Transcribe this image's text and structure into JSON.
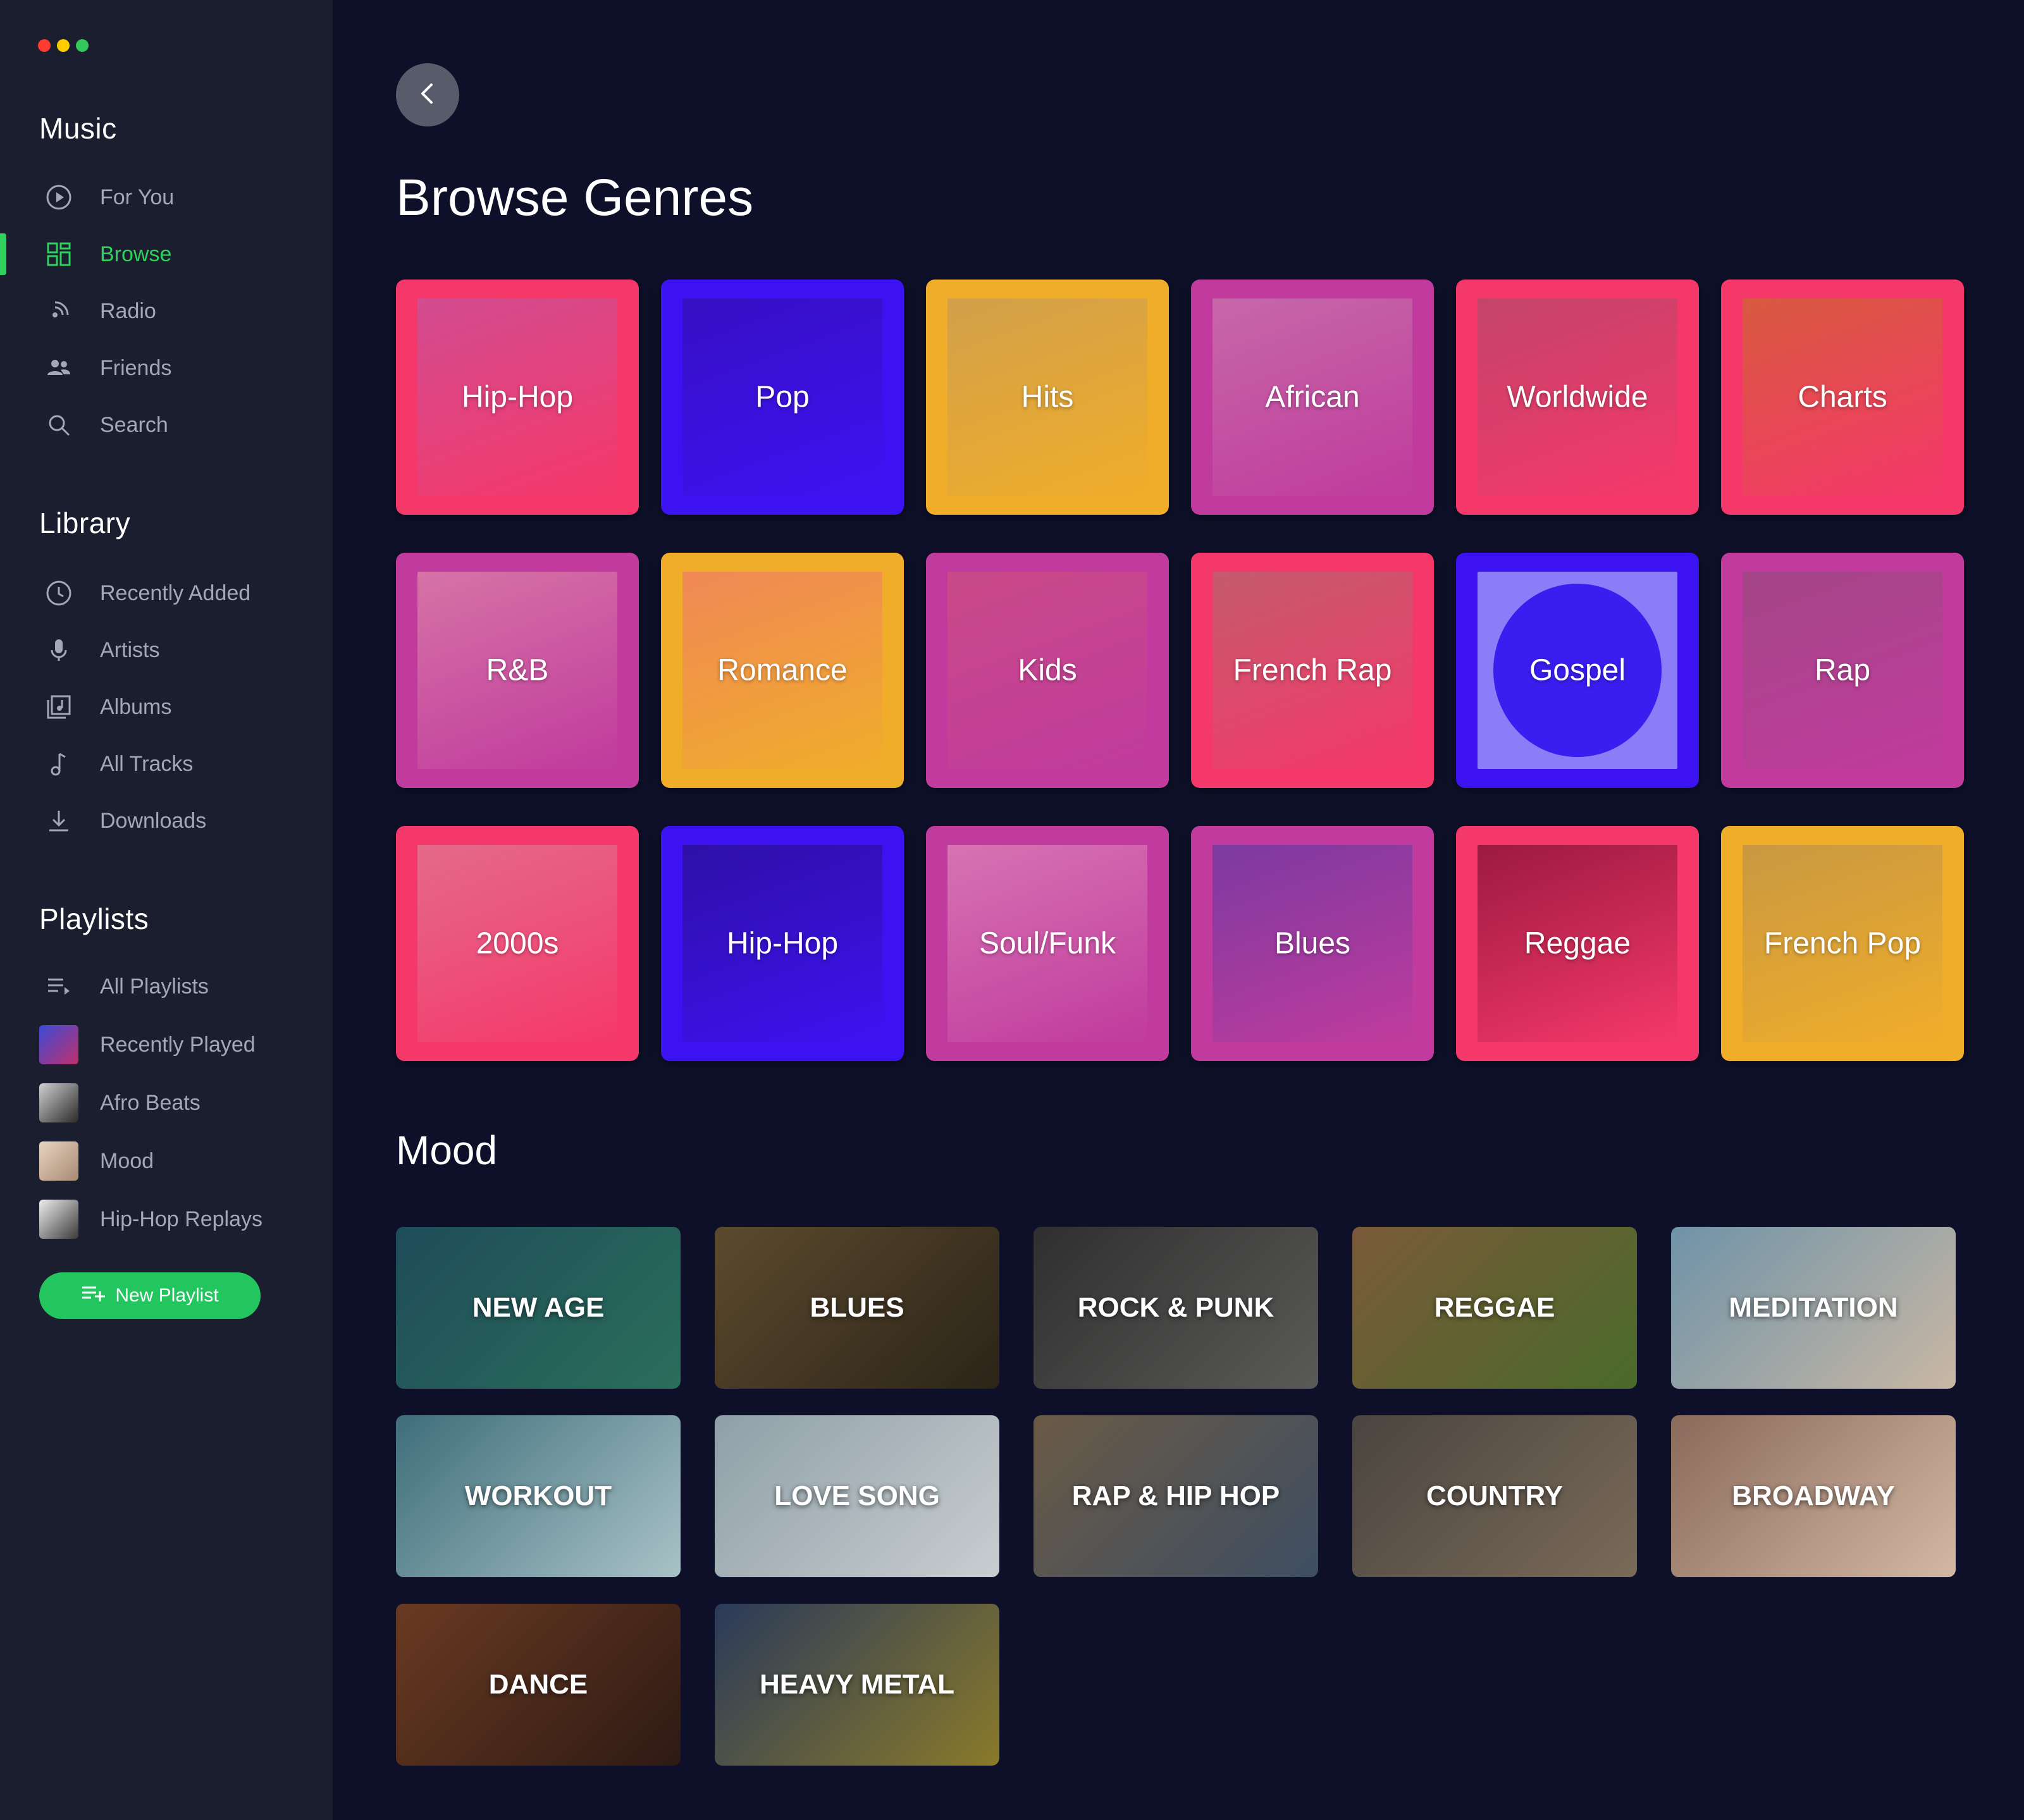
{
  "colors": {
    "accent": "#2ed15c",
    "button_green": "#22c55e",
    "sidebar_bg": "#1b1e2f",
    "main_bg": "#0d1028",
    "traffic_red": "#ff3b30",
    "traffic_yellow": "#ffcc00",
    "traffic_green": "#34c759"
  },
  "sidebar": {
    "music_title": "Music",
    "music_items": [
      {
        "label": "For You",
        "icon": "play-circle-icon"
      },
      {
        "label": "Browse",
        "icon": "grid-icon",
        "active": true
      },
      {
        "label": "Radio",
        "icon": "radio-icon"
      },
      {
        "label": "Friends",
        "icon": "friends-icon"
      },
      {
        "label": "Search",
        "icon": "search-icon"
      }
    ],
    "library_title": "Library",
    "library_items": [
      {
        "label": "Recently Added",
        "icon": "clock-icon"
      },
      {
        "label": "Artists",
        "icon": "microphone-icon"
      },
      {
        "label": "Albums",
        "icon": "album-icon"
      },
      {
        "label": "All Tracks",
        "icon": "music-note-icon"
      },
      {
        "label": "Downloads",
        "icon": "download-icon"
      }
    ],
    "playlists_title": "Playlists",
    "playlist_items": [
      {
        "label": "All Playlists",
        "icon": "playlist-icon"
      },
      {
        "label": "Recently Played",
        "thumb": "#6b3fb3"
      },
      {
        "label": "Afro Beats",
        "thumb": "#4a4a4a"
      },
      {
        "label": "Mood",
        "thumb": "#c9a98e"
      },
      {
        "label": "Hip-Hop Replays",
        "thumb": "#8a8a8a"
      }
    ],
    "new_playlist_label": "New Playlist"
  },
  "main": {
    "title": "Browse Genres",
    "genres": [
      {
        "label": "Hip-Hop",
        "frame": "#f5386a",
        "art": "#d24c8f"
      },
      {
        "label": "Pop",
        "frame": "#3d12f2",
        "art": "#3710c4"
      },
      {
        "label": "Hits",
        "frame": "#f0ad2a",
        "art": "#d2a04a"
      },
      {
        "label": "African",
        "frame": "#c03b9d",
        "art": "#c668a8"
      },
      {
        "label": "Worldwide",
        "frame": "#f5386a",
        "art": "#c44469"
      },
      {
        "label": "Charts",
        "frame": "#f5386a",
        "art": "#d8593f"
      },
      {
        "label": "R&B",
        "frame": "#c03b9d",
        "art": "#d673a6"
      },
      {
        "label": "Romance",
        "frame": "#f0ad2a",
        "art": "#f08856"
      },
      {
        "label": "Kids",
        "frame": "#c03b9d",
        "art": "#c94a88"
      },
      {
        "label": "French Rap",
        "frame": "#f5386a",
        "art": "#c45a6d"
      },
      {
        "label": "Gospel",
        "frame": "#3d12f2",
        "art": "#8b7cf8",
        "disc": true
      },
      {
        "label": "Rap",
        "frame": "#c03b9d",
        "art": "#a44687"
      },
      {
        "label": "2000s",
        "frame": "#f5386a",
        "art": "#e46a8a"
      },
      {
        "label": "Hip-Hop",
        "frame": "#3d12f2",
        "art": "#2d10a6"
      },
      {
        "label": "Soul/Funk",
        "frame": "#c03b9d",
        "art": "#d773b3"
      },
      {
        "label": "Blues",
        "frame": "#c03b9d",
        "art": "#7c3aa0"
      },
      {
        "label": "Reggae",
        "frame": "#f5386a",
        "art": "#9c1a3f"
      },
      {
        "label": "French Pop",
        "frame": "#f0ad2a",
        "art": "#c99841"
      }
    ],
    "mood_title": "Mood",
    "moods": [
      {
        "label": "NEW AGE",
        "bg": "#1f4c5a",
        "bg2": "#2a6e5a"
      },
      {
        "label": "BLUES",
        "bg": "#5c4a2e",
        "bg2": "#2b2418"
      },
      {
        "label": "ROCK & PUNK",
        "bg": "#2f2f2f",
        "bg2": "#5a5a58"
      },
      {
        "label": "REGGAE",
        "bg": "#7a5a3a",
        "bg2": "#4a6a2a"
      },
      {
        "label": "MEDITATION",
        "bg": "#6f93a8",
        "bg2": "#c9b7a4"
      },
      {
        "label": "WORKOUT",
        "bg": "#3e6e7a",
        "bg2": "#a9c2c7"
      },
      {
        "label": "LOVE SONG",
        "bg": "#8fa0a8",
        "bg2": "#c8cdd0"
      },
      {
        "label": "RAP & HIP HOP",
        "bg": "#6a5a46",
        "bg2": "#3e4e62"
      },
      {
        "label": "COUNTRY",
        "bg": "#4a4540",
        "bg2": "#7a6a58"
      },
      {
        "label": "BROADWAY",
        "bg": "#8a6a5a",
        "bg2": "#d3b8a5"
      },
      {
        "label": "DANCE",
        "bg": "#6a3a22",
        "bg2": "#2e1a14"
      },
      {
        "label": "HEAVY METAL",
        "bg": "#2a3a5a",
        "bg2": "#8a7a2a"
      }
    ]
  }
}
